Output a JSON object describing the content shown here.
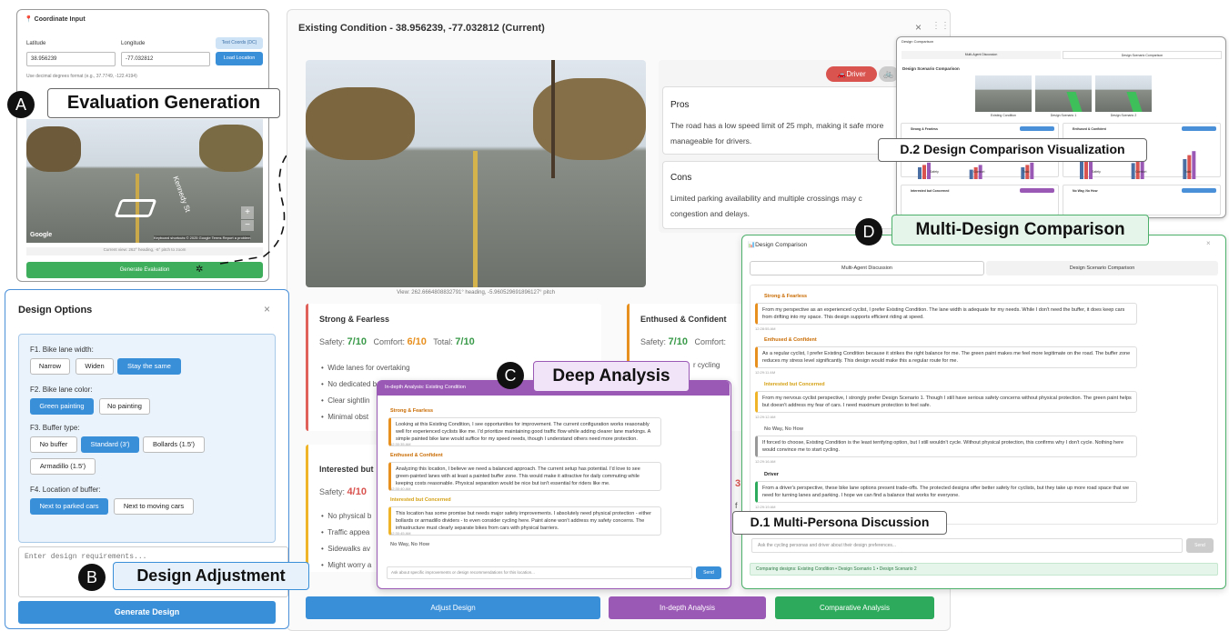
{
  "coord_panel": {
    "title": "Coordinate Input",
    "lat_label": "Latitude",
    "lon_label": "Longitude",
    "lat_value": "38.956239",
    "lon_value": "-77.032812",
    "test_button": "Test Coords (DC)",
    "load_button": "Load Location",
    "hint": "Use decimal degrees format (e.g., 37.7749, -122.4194)",
    "map_brand": "Google",
    "map_footer": "Keyboard shortcuts  © 2025 Google  Terms  Report a problem",
    "view_text": "Current view: 262° heading, -6° pitch to zoom",
    "generate_button": "Generate Evaluation",
    "street_label": "Kennedy St"
  },
  "labels": {
    "a_letter": "A",
    "a_text": "Evaluation Generation",
    "b_letter": "B",
    "b_text": "Design Adjustment",
    "c_letter": "C",
    "c_text": "Deep Analysis",
    "d_letter": "D",
    "d_text": "Multi-Design Comparison",
    "d1_text": "D.1 Multi-Persona Discussion",
    "d2_text": "D.2 Design Comparison Visualization"
  },
  "main": {
    "title": "Existing Condition - 38.956239, -77.032812 (Current)",
    "view_caption": "View: 262.6664808832791° heading, -5.960529691896127° pitch",
    "driver_tab": "Driver",
    "pros_title": "Pros",
    "pros_text": "The road has a low speed limit of 25 mph, making it safe more manageable for drivers.",
    "cons_title": "Cons",
    "cons_text": "Limited parking availability and multiple crossings may c congestion and delays.",
    "card1_title": "Strong & Fearless",
    "card1_safety_label": "Safety:",
    "card1_safety": "7/10",
    "card1_comfort_label": "Comfort:",
    "card1_comfort": "6/10",
    "card1_total_label": "Total:",
    "card1_total": "7/10",
    "card1_b1": "Wide lanes for overtaking",
    "card1_b2": "No dedicated b",
    "card1_b3": "Clear sightlin",
    "card1_b4": "Minimal obst",
    "card2_title": "Enthused & Confident",
    "card2_safety_label": "Safety:",
    "card2_safety": "7/10",
    "card2_comfort_label": "Comfort:",
    "card2_b1": "r cycling",
    "card2_b2": "zo",
    "card3_title": "Interested but",
    "card3_safety_label": "Safety:",
    "card3_safety": "4/10",
    "card3_b1": "No physical b",
    "card3_b2": "Traffic appea",
    "card3_b3": "Sidewalks av",
    "card3_b4": "Might worry a",
    "card4_frag1": "3",
    "card4_frag2": "f",
    "btn_adjust": "Adjust Design",
    "btn_indepth": "In-depth Analysis",
    "btn_compare": "Comparative Analysis"
  },
  "design_options": {
    "title": "Design Options",
    "f1": "F1. Bike lane width:",
    "f1_opts": [
      "Narrow",
      "Widen",
      "Stay the same"
    ],
    "f2": "F2. Bike lane color:",
    "f2_opts": [
      "Green painting",
      "No painting"
    ],
    "f3": "F3. Buffer type:",
    "f3_opts": [
      "No buffer",
      "Standard (3')",
      "Bollards (1.5')",
      "Armadillo (1.5')"
    ],
    "f4": "F4. Location of buffer:",
    "f4_opts": [
      "Next to parked cars",
      "Next to moving cars"
    ],
    "textarea_placeholder": "Enter design requirements...",
    "generate_button": "Generate Design"
  },
  "indepth": {
    "title": "In-depth Analysis: Existing Condition",
    "p1": "Strong & Fearless",
    "m1": "Looking at this Existing Condition, I see opportunities for improvement. The current configuration works reasonably well for experienced cyclists like me. I'd prioritize maintaining good traffic flow while adding clearer lane markings. A simple painted bike lane would suffice for my speed needs, though I understand others need more protection.",
    "t1": "12:30:35 AM",
    "p2": "Enthused & Confident",
    "m2": "Analyzing this location, I believe we need a balanced approach. The current setup has potential. I'd love to see green-painted lanes with at least a painted buffer zone. This would make it attractive for daily commuting while keeping costs reasonable. Physical separation would be nice but isn't essential for riders like me.",
    "t2": "12:30:40 AM",
    "p3": "Interested but Concerned",
    "m3": "This location has some promise but needs major safety improvements. I absolutely need physical protection - either bollards or armadillo dividers - to even consider cycling here. Paint alone won't address my safety concerns. The infrastructure must clearly separate bikes from cars with physical barriers.",
    "t3": "12:30:45 AM",
    "p4": "No Way, No How",
    "input_placeholder": "Ask about specific improvements or design recommendations for this location...",
    "send": "Send"
  },
  "comparison": {
    "title": "Design Comparison",
    "tab1": "Multi-Agent Discussion",
    "tab2": "Design Scenario Comparison",
    "p1": "Strong & Fearless",
    "m1": "From my perspective as an experienced cyclist, I prefer Existing Condition. The lane width is adequate for my needs. While I don't need the buffer, it does keep cars from drifting into my space. This design supports efficient riding at speed.",
    "t1": "12:28:55 AM",
    "p2": "Enthused & Confident",
    "m2": "As a regular cyclist, I prefer Existing Condition because it strikes the right balance for me. The green paint makes me feel more legitimate on the road. The buffer zone reduces my stress level significantly. This design would make this a regular route for me.",
    "t2": "12:29:11 AM",
    "p3": "Interested but Concerned",
    "m3": "From my nervous cyclist perspective, I strongly prefer Design Scenario 1. Though I still have serious safety concerns without physical protection. The green paint helps but doesn't address my fear of cars. I need maximum protection to feel safe.",
    "t3": "12:29:12 AM",
    "p4": "No Way, No How",
    "m4": "If forced to choose, Existing Condition is the least terrifying option, but I still wouldn't cycle. Without physical protection, this confirms why I don't cycle. Nothing here would convince me to start cycling.",
    "t4": "12:29:16 AM",
    "p5": "Driver",
    "m5": "From a driver's perspective, these bike lane options present trade-offs. The protected designs offer better safety for cyclists, but they take up more road space that we need for turning lanes and parking. I hope we can find a balance that works for everyone.",
    "t5": "12:29:19 AM",
    "input_placeholder": "Ask the cycling personas and driver about their design preferences...",
    "send": "Send",
    "footer": "Comparing designs: Existing Condition • Design Scenario 1 • Design Scenario 2"
  },
  "viz": {
    "title": "Design Comparison",
    "tab1": "Multi-Agent Discussion",
    "tab2": "Design Scenario Comparison",
    "heading": "Design Scenario Comparison",
    "img1": "Existing Condition",
    "img2": "Design Scenario 1",
    "img3": "Design Scenario 2",
    "p1": "Strong & Fearless",
    "p2": "Enthused & Confident",
    "p3": "Interested but Concerned",
    "p4": "No Way, No How",
    "x1": "Safety",
    "x2": "Comfort",
    "x3": "Total"
  },
  "chart_data": {
    "type": "bar",
    "categories": [
      "Safety",
      "Comfort",
      "Total"
    ],
    "series": [
      {
        "values": [
          5,
          4,
          5
        ]
      },
      {
        "values": [
          6,
          5,
          6
        ]
      },
      {
        "values": [
          7,
          6,
          7
        ]
      }
    ]
  },
  "colors": {
    "primary": "#3a8fd9",
    "purple": "#9b59b6",
    "green": "#2eaa5c",
    "orange": "#e8901f",
    "red": "#d9534f",
    "comparison_border": "#4caf6a"
  }
}
